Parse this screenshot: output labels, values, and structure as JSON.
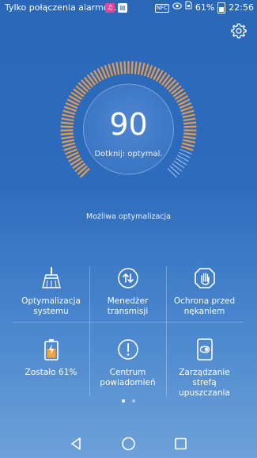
{
  "status_bar": {
    "carrier": "Tylko połączenia alarmo...",
    "music_icon": "music-icon",
    "pad_icon": "pad-icon",
    "nfc": "NFC",
    "battery": "61%",
    "time": "22:56"
  },
  "gauge": {
    "score": "90",
    "hint": "Dotknij: optymal.",
    "progress": 0.9,
    "arc_color": "#e8994a"
  },
  "possible_text": "Możliwa optymalizacja",
  "tiles": [
    {
      "label": "Optymalizacja systemu",
      "icon": "broom-icon"
    },
    {
      "label": "Menedżer transmisji",
      "icon": "transfer-icon"
    },
    {
      "label": "Ochrona przed nękaniem",
      "icon": "hand-shield-icon"
    },
    {
      "label": "Zostało 61%",
      "icon": "battery-icon"
    },
    {
      "label": "Centrum powiadomień",
      "icon": "notification-icon"
    },
    {
      "label": "Zarządzanie strefą upuszczania",
      "icon": "dropzone-icon"
    }
  ],
  "pager": {
    "pages": 2,
    "current": 1
  },
  "navigation": {
    "back": "back-icon",
    "home": "home-icon",
    "recents": "recents-icon"
  }
}
